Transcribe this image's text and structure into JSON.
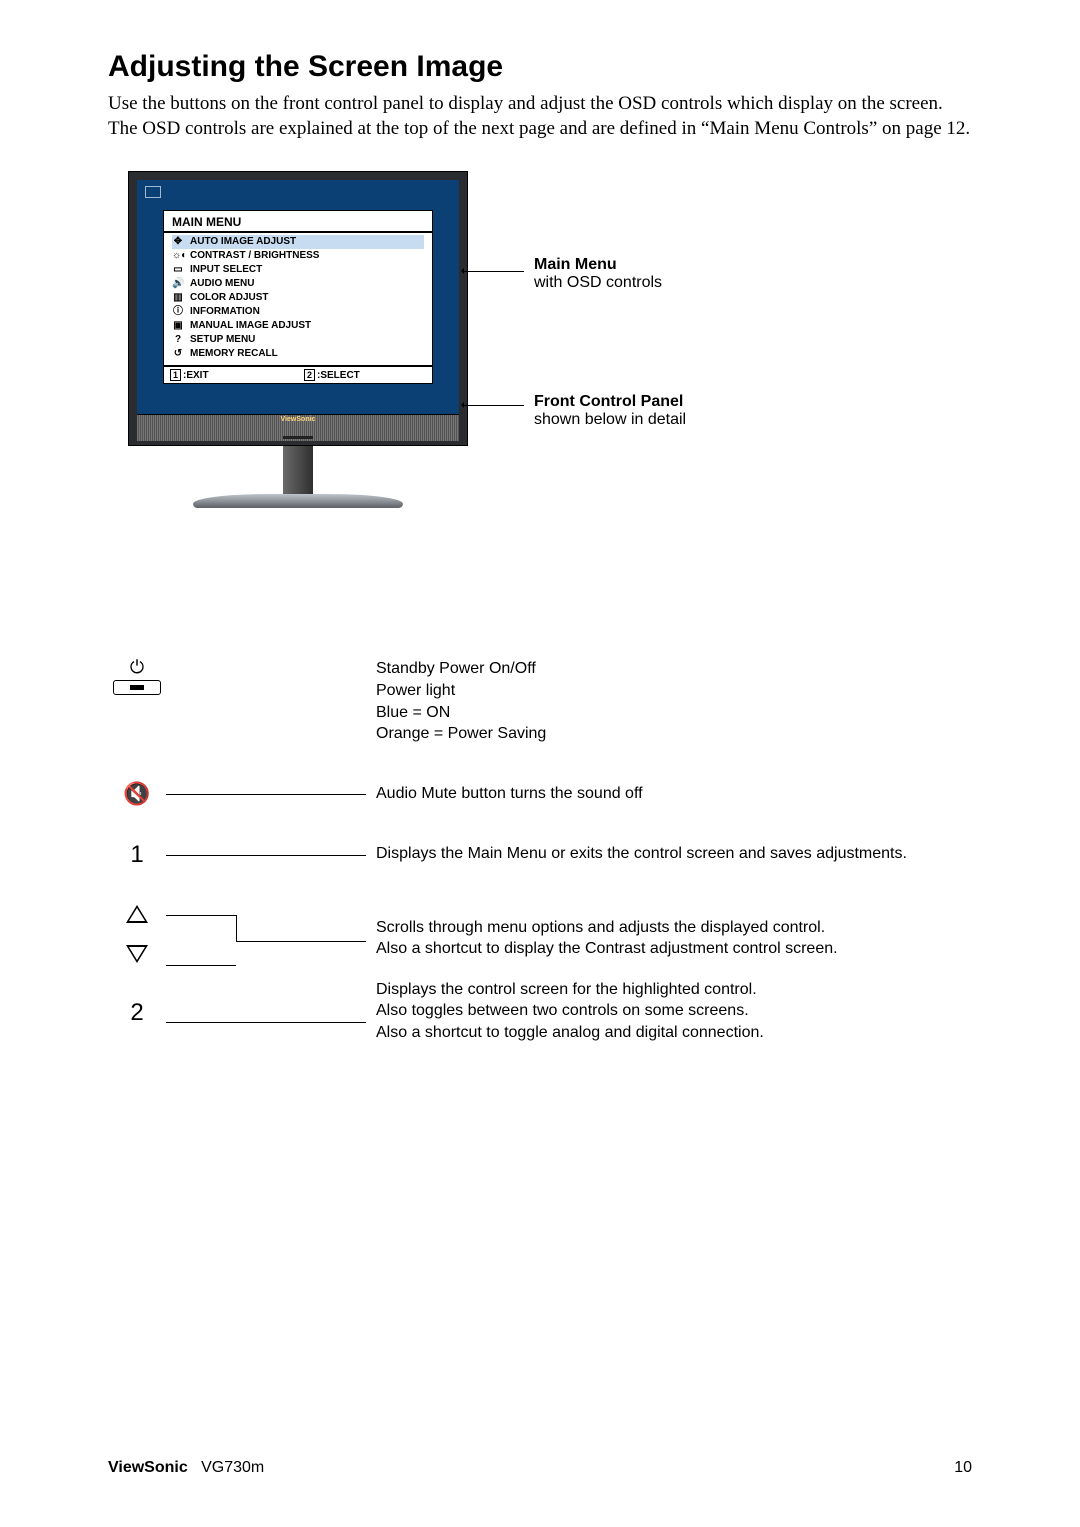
{
  "heading": "Adjusting the Screen Image",
  "intro": "Use the buttons on the front control panel to display and adjust the OSD controls which display on the screen. The OSD controls are explained at the top of the next page and are defined in “Main Menu Controls” on page 12.",
  "osd": {
    "title": "MAIN MENU",
    "items": [
      "AUTO IMAGE ADJUST",
      "CONTRAST / BRIGHTNESS",
      "INPUT SELECT",
      "AUDIO MENU",
      "COLOR ADJUST",
      "INFORMATION",
      "MANUAL IMAGE ADJUST",
      "SETUP MENU",
      "MEMORY RECALL"
    ],
    "foot_exit_key": "1",
    "foot_exit_label": ":EXIT",
    "foot_select_key": "2",
    "foot_select_label": ":SELECT",
    "brand": "ViewSonic"
  },
  "callout1": {
    "title": "Main Menu",
    "sub": "with OSD controls"
  },
  "callout2": {
    "title": "Front Control Panel",
    "sub": "shown below in detail"
  },
  "controls": {
    "power": {
      "l1": "Standby Power On/Off",
      "l2": "Power light",
      "l3": "Blue = ON",
      "l4": "Orange = Power Saving"
    },
    "mute": "Audio Mute button turns the sound off",
    "btn1": "Displays the Main Menu or exits the control screen and saves adjustments.",
    "arrows": {
      "l1": "Scrolls through menu options and adjusts the displayed control.",
      "l2": "Also a shortcut to display the Contrast adjustment control screen."
    },
    "btn2": {
      "l1": "Displays the control screen for the highlighted control.",
      "l2": "Also toggles between two controls on some screens.",
      "l3": "Also a shortcut to toggle analog and digital connection."
    },
    "labels": {
      "one": "1",
      "two": "2"
    }
  },
  "footer": {
    "brand": "ViewSonic",
    "model": "VG730m",
    "page": "10"
  }
}
